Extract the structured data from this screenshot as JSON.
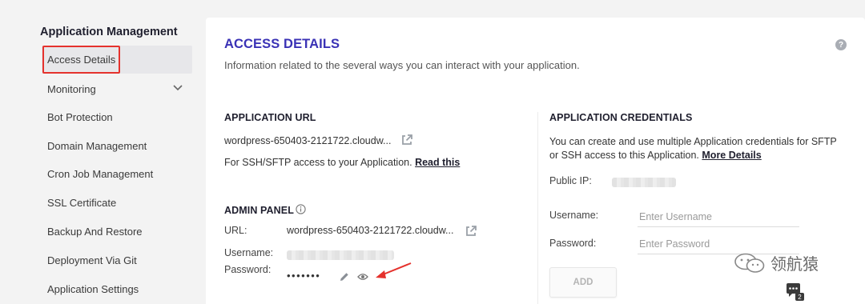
{
  "sidebar": {
    "heading": "Application Management",
    "items": [
      {
        "label": "Access Details"
      },
      {
        "label": "Monitoring"
      },
      {
        "label": "Bot Protection"
      },
      {
        "label": "Domain Management"
      },
      {
        "label": "Cron Job Management"
      },
      {
        "label": "SSL Certificate"
      },
      {
        "label": "Backup And Restore"
      },
      {
        "label": "Deployment Via Git"
      },
      {
        "label": "Application Settings"
      }
    ]
  },
  "main": {
    "title": "ACCESS DETAILS",
    "subtitle": "Information related to the several ways you can interact with your application.",
    "help_icon_text": "?",
    "app_url": {
      "title": "APPLICATION URL",
      "url": "wordpress-650403-2121722.cloudw...",
      "ssh_note": "For SSH/SFTP access to your Application.",
      "read_this": "Read this"
    },
    "admin_panel": {
      "title": "ADMIN PANEL",
      "url_label": "URL:",
      "url_value": "wordpress-650403-2121722.cloudw...",
      "username_label": "Username:",
      "password_label": "Password:",
      "password_mask": "•••••••"
    },
    "credentials": {
      "title": "APPLICATION CREDENTIALS",
      "description_line1": "You can create and use multiple Application credentials for SFTP",
      "description_line2": "or SSH access to this Application.",
      "more_details": "More Details",
      "public_ip_label": "Public IP:",
      "username_label": "Username:",
      "username_placeholder": "Enter Username",
      "password_label": "Password:",
      "password_placeholder": "Enter Password",
      "add_button": "ADD"
    }
  },
  "watermark": {
    "text": "领航猿",
    "badge": "2"
  },
  "colors": {
    "accent": "#3a32b5",
    "highlight": "#e5322d",
    "background": "#f3f3f3",
    "panel": "#ffffff"
  }
}
